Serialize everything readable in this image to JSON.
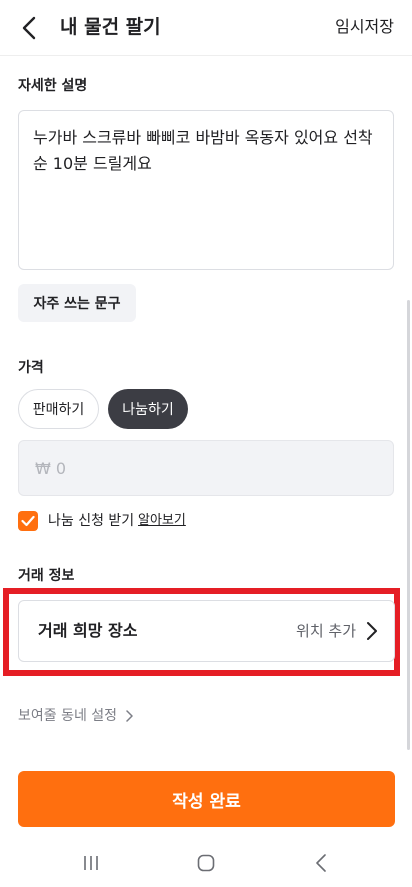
{
  "header": {
    "title": "내 물건 팔기",
    "save_draft": "임시저장"
  },
  "description": {
    "label": "자세한 설명",
    "text": "누가바 스크류바 빠삐코 바밤바 옥동자 있어요 선착순 10분 드릴게요",
    "frequent_phrases": "자주 쓰는 문구"
  },
  "price": {
    "label": "가격",
    "options": [
      "판매하기",
      "나눔하기"
    ],
    "selected": "나눔하기",
    "placeholder": "₩ 0",
    "share_request": {
      "label": "나눔 신청 받기",
      "checked": true,
      "learn_more": "알아보기"
    }
  },
  "deal": {
    "label": "거래 정보",
    "place_title": "거래 희망 장소",
    "place_action": "위치 추가"
  },
  "neighborhood_setting": "보여줄 동네 설정",
  "submit": "작성 완료",
  "colors": {
    "accent": "#ff6f0f",
    "chip_selected": "#3c3d44",
    "highlight_frame": "#e51e25"
  }
}
